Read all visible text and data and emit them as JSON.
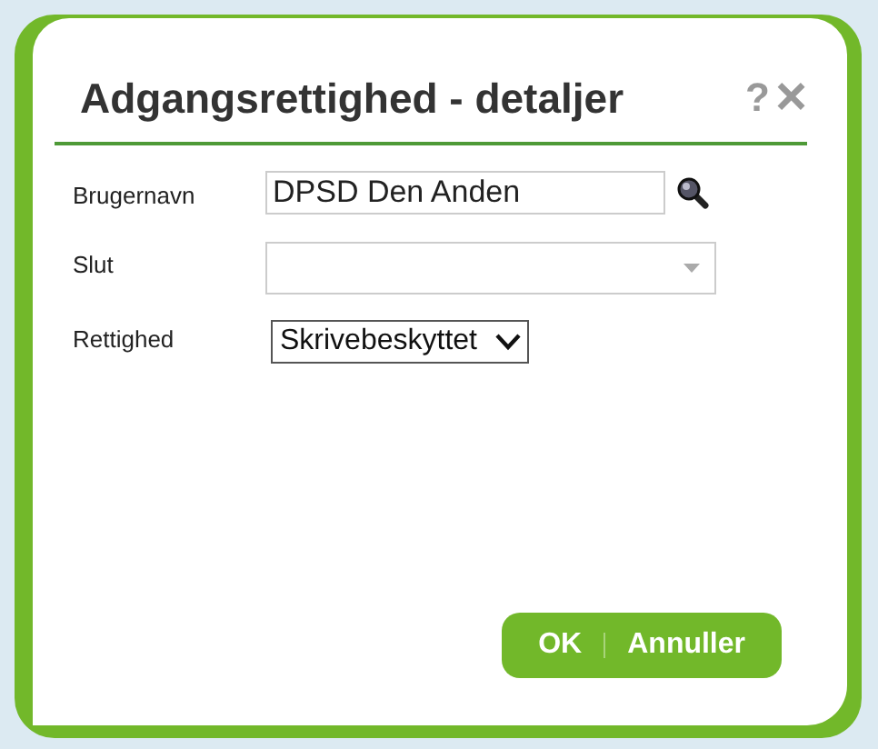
{
  "dialog": {
    "title": "Adgangsrettighed - detaljer",
    "help": "?",
    "close": "×"
  },
  "fields": [
    {
      "kind": "text",
      "label": "Brugernavn",
      "value": "DPSD Den Anden",
      "lookup": true
    },
    {
      "kind": "combo",
      "label": "Slut"
    },
    {
      "kind": "select",
      "label": "Rettighed",
      "value": "Skrivebeskyttet"
    }
  ],
  "buttons": [
    {
      "label": "OK"
    },
    {
      "label": "Annuller"
    }
  ]
}
